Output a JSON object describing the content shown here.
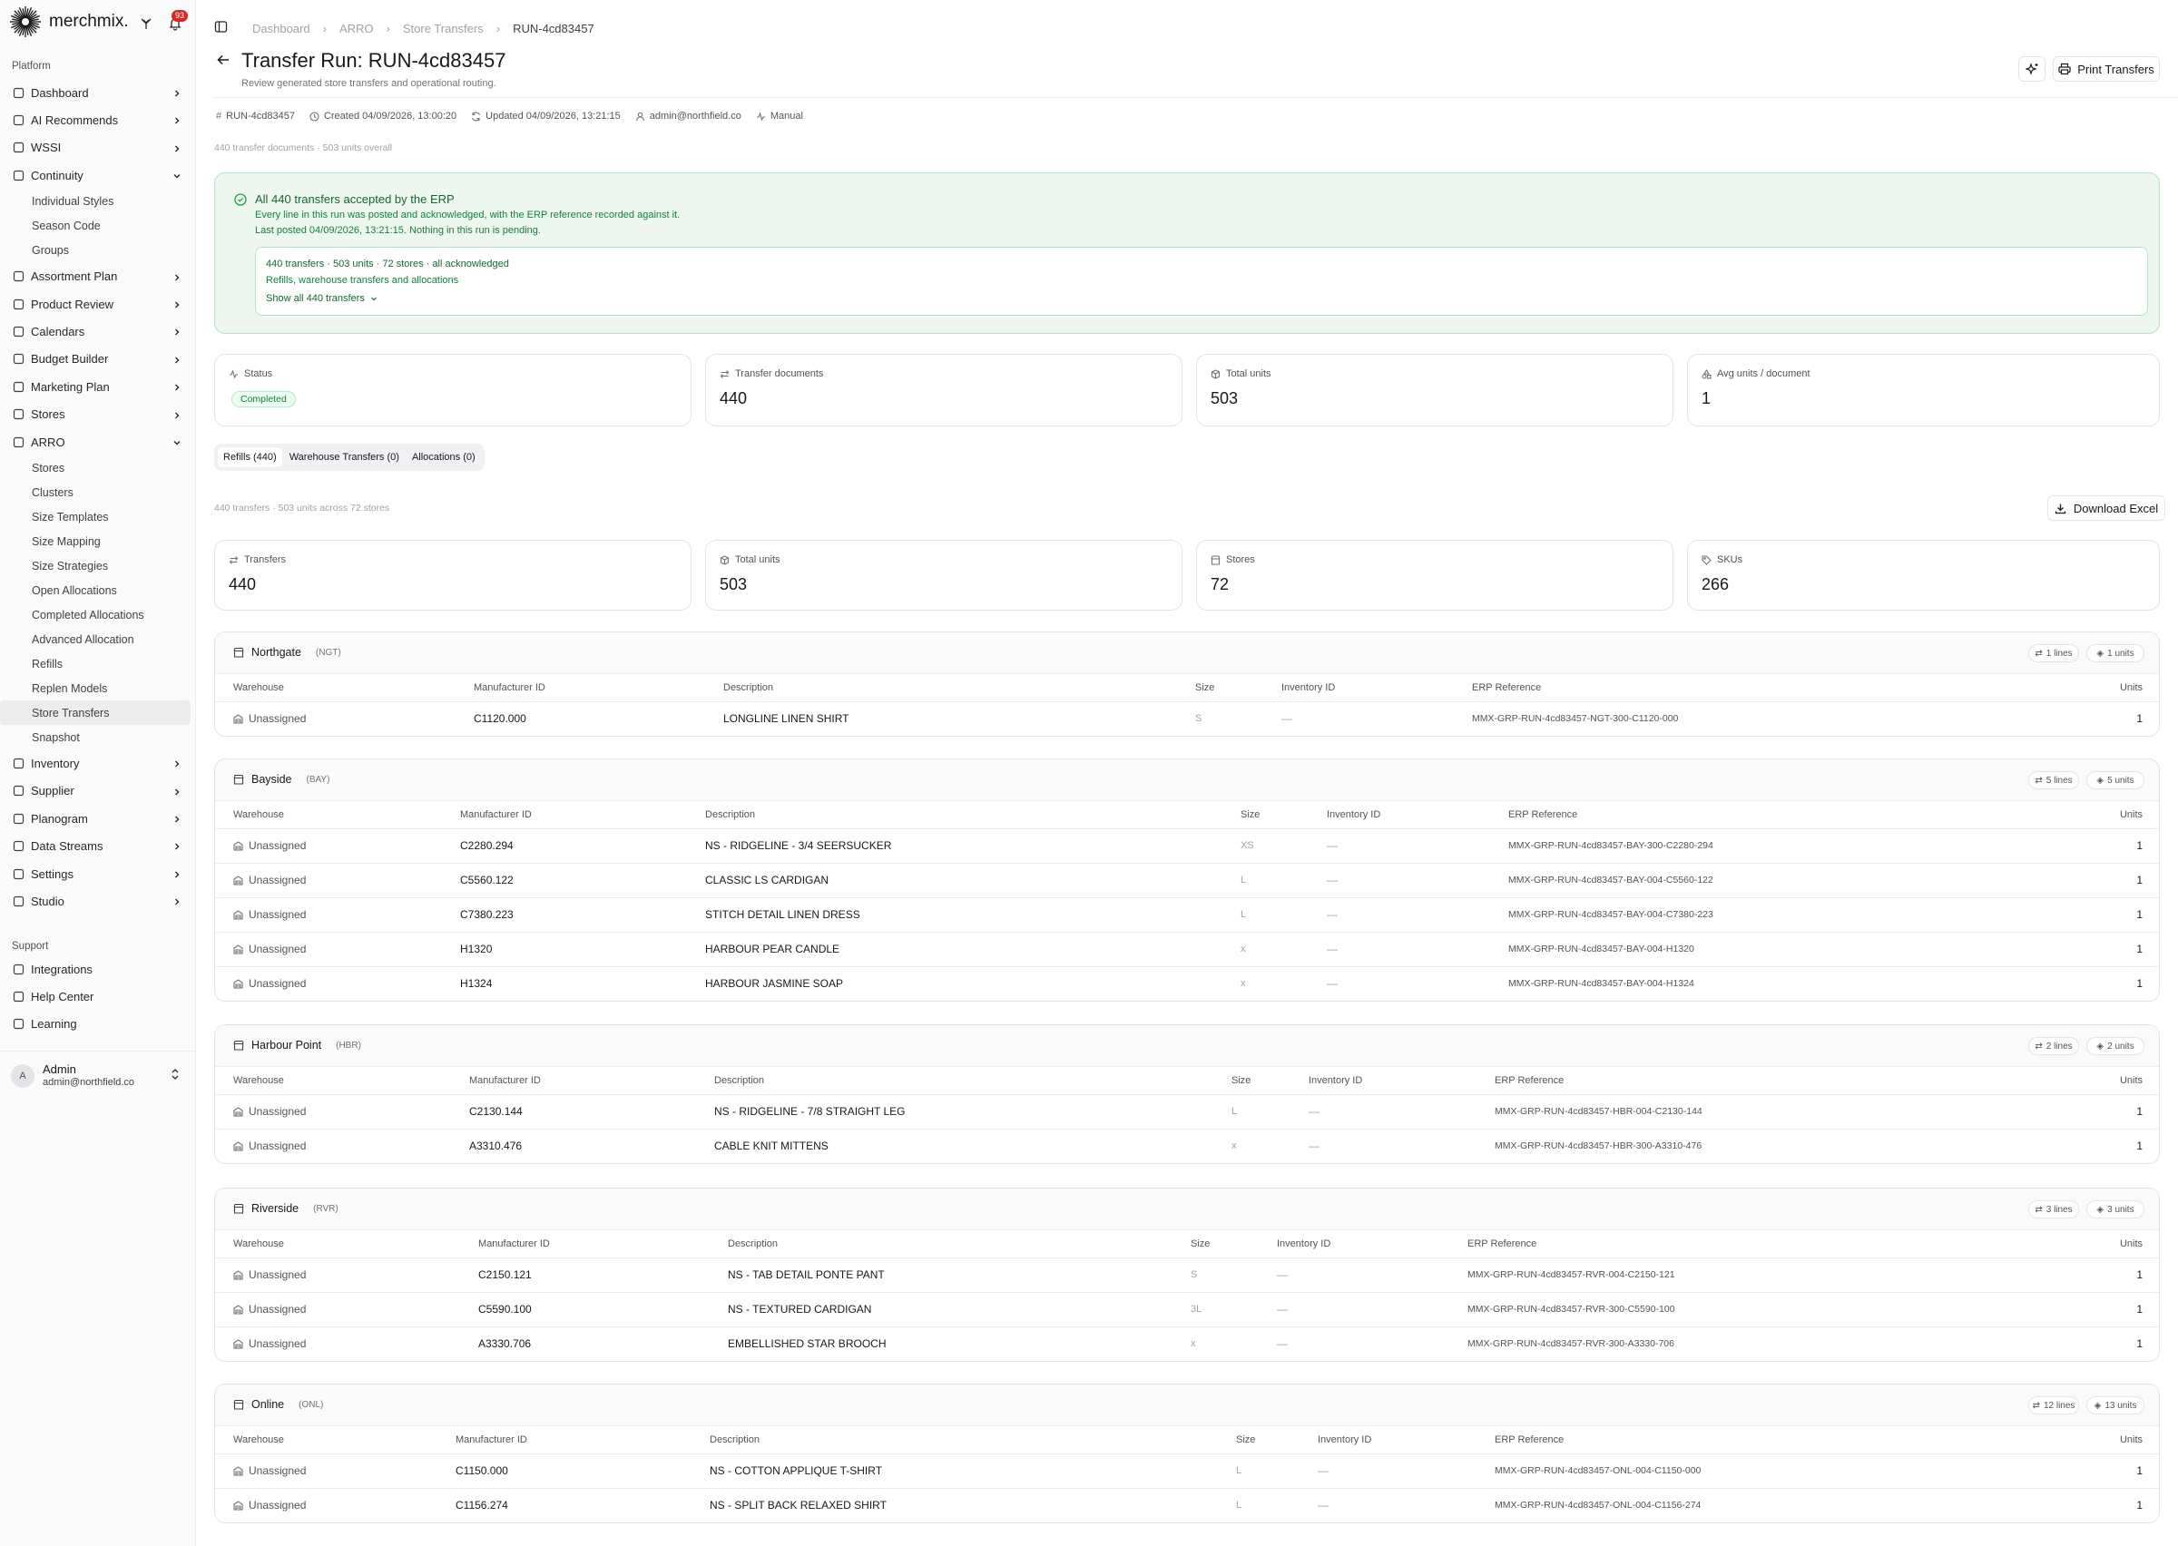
{
  "app": {
    "brand": "merchmix.",
    "notifications_count": "93"
  },
  "sidebar": {
    "platform_label": "Platform",
    "items": [
      {
        "label": "Dashboard",
        "icon": "dashboard-icon",
        "chevron": "right"
      },
      {
        "label": "AI Recommends",
        "icon": "ai-icon",
        "chevron": "right"
      },
      {
        "label": "WSSI",
        "icon": "grid-icon",
        "chevron": "right"
      },
      {
        "label": "Continuity",
        "icon": "shirt-icon",
        "chevron": "down",
        "children": [
          "Individual Styles",
          "Season Code",
          "Groups"
        ]
      },
      {
        "label": "Assortment Plan",
        "icon": "list-icon",
        "chevron": "right"
      },
      {
        "label": "Product Review",
        "icon": "review-icon",
        "chevron": "right"
      },
      {
        "label": "Calendars",
        "icon": "calendar-icon",
        "chevron": "right"
      },
      {
        "label": "Budget Builder",
        "icon": "budget-icon",
        "chevron": "right"
      },
      {
        "label": "Marketing Plan",
        "icon": "target-icon",
        "chevron": "right"
      },
      {
        "label": "Stores",
        "icon": "store-icon",
        "chevron": "right"
      },
      {
        "label": "ARRO",
        "icon": "arro-icon",
        "chevron": "down",
        "children": [
          "Stores",
          "Clusters",
          "Size Templates",
          "Size Mapping",
          "Size Strategies",
          "Open Allocations",
          "Completed Allocations",
          "Advanced Allocation",
          "Refills",
          "Replen Models",
          "Store Transfers",
          "Snapshot"
        ]
      },
      {
        "label": "Inventory",
        "icon": "inventory-icon",
        "chevron": "right"
      },
      {
        "label": "Supplier",
        "icon": "supplier-icon",
        "chevron": "right"
      },
      {
        "label": "Planogram",
        "icon": "planogram-icon",
        "chevron": "right"
      },
      {
        "label": "Data Streams",
        "icon": "share-icon",
        "chevron": "right"
      },
      {
        "label": "Settings",
        "icon": "gear-icon",
        "chevron": "right"
      },
      {
        "label": "Studio",
        "icon": "studio-icon",
        "chevron": "right"
      }
    ],
    "support_label": "Support",
    "support_items": [
      {
        "label": "Integrations",
        "icon": "plug-icon"
      },
      {
        "label": "Help Center",
        "icon": "help-icon"
      },
      {
        "label": "Learning",
        "icon": "book-icon"
      }
    ],
    "user": {
      "initial": "A",
      "name": "Admin",
      "email": "admin@northfield.co"
    }
  },
  "header": {
    "breadcrumb": [
      "Dashboard",
      "ARRO",
      "Store Transfers",
      "RUN-4cd83457"
    ],
    "title": "Transfer Run: RUN-4cd83457",
    "subtitle": "Review generated store transfers and operational routing.",
    "print_label": "Print Transfers",
    "meta": {
      "run_id": "RUN-4cd83457",
      "created": "Created 04/09/2026, 13:00:20",
      "updated": "Updated 04/09/2026, 13:21:15",
      "user": "admin@northfield.co",
      "mode": "Manual"
    },
    "summary": "440 transfer documents · 503 units overall"
  },
  "banner": {
    "title": "All 440 transfers accepted by the ERP",
    "line1": "Every line in this run was posted and acknowledged, with the ERP reference recorded against it.",
    "line2": "Last posted 04/09/2026, 13:21:15. Nothing in this run is pending.",
    "inner1": "440 transfers · 503 units · 72 stores · all acknowledged",
    "inner2": "Refills, warehouse transfers and allocations",
    "show_all": "Show all 440 transfers"
  },
  "stats": {
    "status": {
      "label": "Status",
      "value": "Completed"
    },
    "docs": {
      "label": "Transfer documents",
      "value": "440"
    },
    "units": {
      "label": "Total units",
      "value": "503"
    },
    "avg": {
      "label": "Avg units / document",
      "value": "1"
    }
  },
  "tabs": [
    "Refills (440)",
    "Warehouse Transfers (0)",
    "Allocations (0)"
  ],
  "refills": {
    "summary": "440 transfers · 503 units across 72 stores",
    "download_label": "Download Excel",
    "stats": {
      "transfers": {
        "label": "Transfers",
        "value": "440"
      },
      "units": {
        "label": "Total units",
        "value": "503"
      },
      "stores": {
        "label": "Stores",
        "value": "72"
      },
      "skus": {
        "label": "SKUs",
        "value": "266"
      }
    }
  },
  "columns": {
    "warehouse": "Warehouse",
    "mfr": "Manufacturer ID",
    "desc": "Description",
    "size": "Size",
    "inv": "Inventory ID",
    "erp": "ERP Reference",
    "units": "Units"
  },
  "stores": [
    {
      "name": "Northgate",
      "code": "(NGT)",
      "lines": "1 lines",
      "units": "1 units",
      "rows": [
        {
          "wh": "Unassigned",
          "mfr": "C1120.000",
          "desc": "LONGLINE LINEN SHIRT",
          "size": "S",
          "inv": "—",
          "erp": "MMX-GRP-RUN-4cd83457-NGT-300-C1120-000",
          "units": "1"
        }
      ]
    },
    {
      "name": "Bayside",
      "code": "(BAY)",
      "lines": "5 lines",
      "units": "5 units",
      "rows": [
        {
          "wh": "Unassigned",
          "mfr": "C2280.294",
          "desc": "NS - RIDGELINE - 3/4 SEERSUCKER",
          "size": "XS",
          "inv": "—",
          "erp": "MMX-GRP-RUN-4cd83457-BAY-300-C2280-294",
          "units": "1"
        },
        {
          "wh": "Unassigned",
          "mfr": "C5560.122",
          "desc": "CLASSIC LS CARDIGAN",
          "size": "L",
          "inv": "—",
          "erp": "MMX-GRP-RUN-4cd83457-BAY-004-C5560-122",
          "units": "1"
        },
        {
          "wh": "Unassigned",
          "mfr": "C7380.223",
          "desc": "STITCH DETAIL LINEN DRESS",
          "size": "L",
          "inv": "—",
          "erp": "MMX-GRP-RUN-4cd83457-BAY-004-C7380-223",
          "units": "1"
        },
        {
          "wh": "Unassigned",
          "mfr": "H1320",
          "desc": "HARBOUR PEAR CANDLE",
          "size": "x",
          "inv": "—",
          "erp": "MMX-GRP-RUN-4cd83457-BAY-004-H1320",
          "units": "1"
        },
        {
          "wh": "Unassigned",
          "mfr": "H1324",
          "desc": "HARBOUR JASMINE SOAP",
          "size": "x",
          "inv": "—",
          "erp": "MMX-GRP-RUN-4cd83457-BAY-004-H1324",
          "units": "1"
        }
      ]
    },
    {
      "name": "Harbour Point",
      "code": "(HBR)",
      "lines": "2 lines",
      "units": "2 units",
      "rows": [
        {
          "wh": "Unassigned",
          "mfr": "C2130.144",
          "desc": "NS - RIDGELINE - 7/8 STRAIGHT LEG",
          "size": "L",
          "inv": "—",
          "erp": "MMX-GRP-RUN-4cd83457-HBR-004-C2130-144",
          "units": "1"
        },
        {
          "wh": "Unassigned",
          "mfr": "A3310.476",
          "desc": "CABLE KNIT MITTENS",
          "size": "x",
          "inv": "—",
          "erp": "MMX-GRP-RUN-4cd83457-HBR-300-A3310-476",
          "units": "1"
        }
      ]
    },
    {
      "name": "Riverside",
      "code": "(RVR)",
      "lines": "3 lines",
      "units": "3 units",
      "rows": [
        {
          "wh": "Unassigned",
          "mfr": "C2150.121",
          "desc": "NS - TAB DETAIL PONTE PANT",
          "size": "S",
          "inv": "—",
          "erp": "MMX-GRP-RUN-4cd83457-RVR-004-C2150-121",
          "units": "1"
        },
        {
          "wh": "Unassigned",
          "mfr": "C5590.100",
          "desc": "NS - TEXTURED CARDIGAN",
          "size": "3L",
          "inv": "—",
          "erp": "MMX-GRP-RUN-4cd83457-RVR-300-C5590-100",
          "units": "1"
        },
        {
          "wh": "Unassigned",
          "mfr": "A3330.706",
          "desc": "EMBELLISHED STAR BROOCH",
          "size": "x",
          "inv": "—",
          "erp": "MMX-GRP-RUN-4cd83457-RVR-300-A3330-706",
          "units": "1"
        }
      ]
    },
    {
      "name": "Online",
      "code": "(ONL)",
      "lines": "12 lines",
      "units": "13 units",
      "rows": [
        {
          "wh": "Unassigned",
          "mfr": "C1150.000",
          "desc": "NS - COTTON APPLIQUE T-SHIRT",
          "size": "L",
          "inv": "—",
          "erp": "MMX-GRP-RUN-4cd83457-ONL-004-C1150-000",
          "units": "1"
        },
        {
          "wh": "Unassigned",
          "mfr": "C1156.274",
          "desc": "NS - SPLIT BACK RELAXED SHIRT",
          "size": "L",
          "inv": "—",
          "erp": "MMX-GRP-RUN-4cd83457-ONL-004-C1156-274",
          "units": "1"
        }
      ]
    }
  ]
}
